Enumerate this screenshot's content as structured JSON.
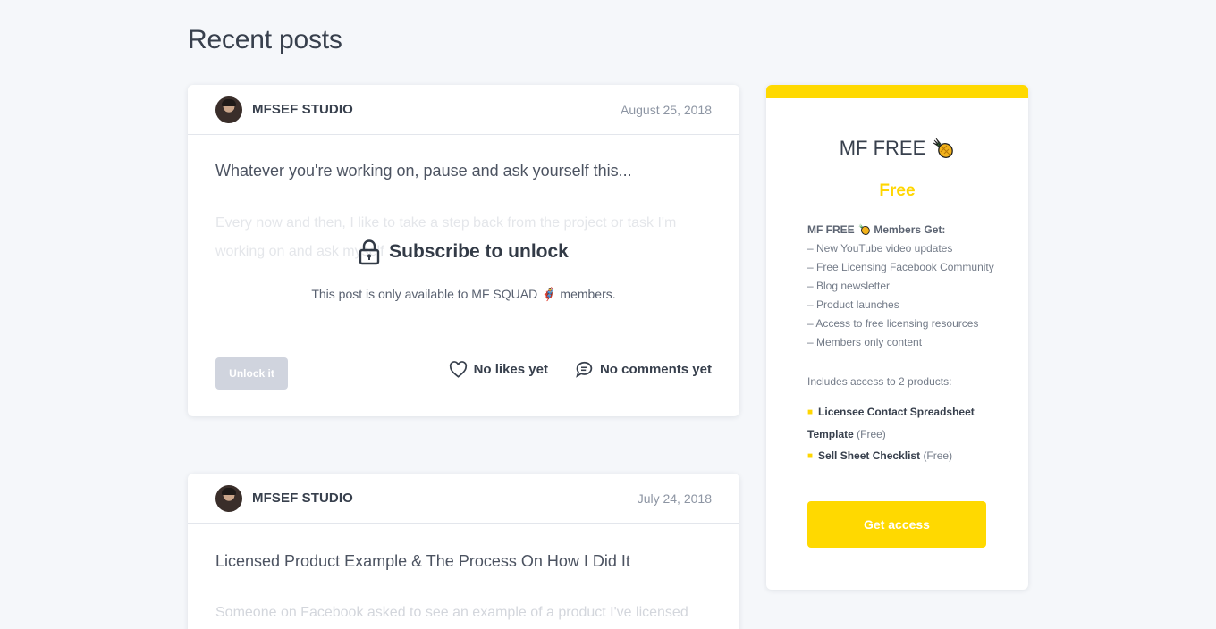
{
  "page": {
    "title": "Recent posts"
  },
  "posts": [
    {
      "author": "MFSEF STUDIO",
      "date": "August 25, 2018",
      "title": "Whatever you're working on, pause and ask yourself this...",
      "excerpt": "Every now and then, I like to take a step back from the project or task I'm working on and ask myself",
      "locked": true,
      "unlock_title": "Subscribe to unlock",
      "unlock_note": "This post is only available to MF SQUAD 🦸 members.",
      "unlock_button": "Unlock it",
      "likes": "No likes yet",
      "comments": "No comments yet"
    },
    {
      "author": "MFSEF STUDIO",
      "date": "July 24, 2018",
      "title": "Licensed Product Example & The Process On How I Did It",
      "excerpt": "Someone on Facebook asked to see an example of a product I've licensed"
    }
  ],
  "tier": {
    "name": "MF FREE",
    "icon": "pineapple-icon",
    "price": "Free",
    "benefits_heading": "MF FREE",
    "benefits_heading_suffix": "Members Get:",
    "benefits": [
      "– New YouTube video updates",
      "– Free Licensing Facebook Community",
      "– Blog newsletter",
      "– Product launches",
      "– Access to free licensing resources",
      "– Members only content"
    ],
    "includes_text": "Includes access to 2 products:",
    "products": [
      {
        "name": "Licensee Contact Spreadsheet Template",
        "price": "(Free)"
      },
      {
        "name": "Sell Sheet Checklist",
        "price": "(Free)"
      }
    ],
    "cta": "Get access",
    "accent_color": "#ffd900"
  }
}
